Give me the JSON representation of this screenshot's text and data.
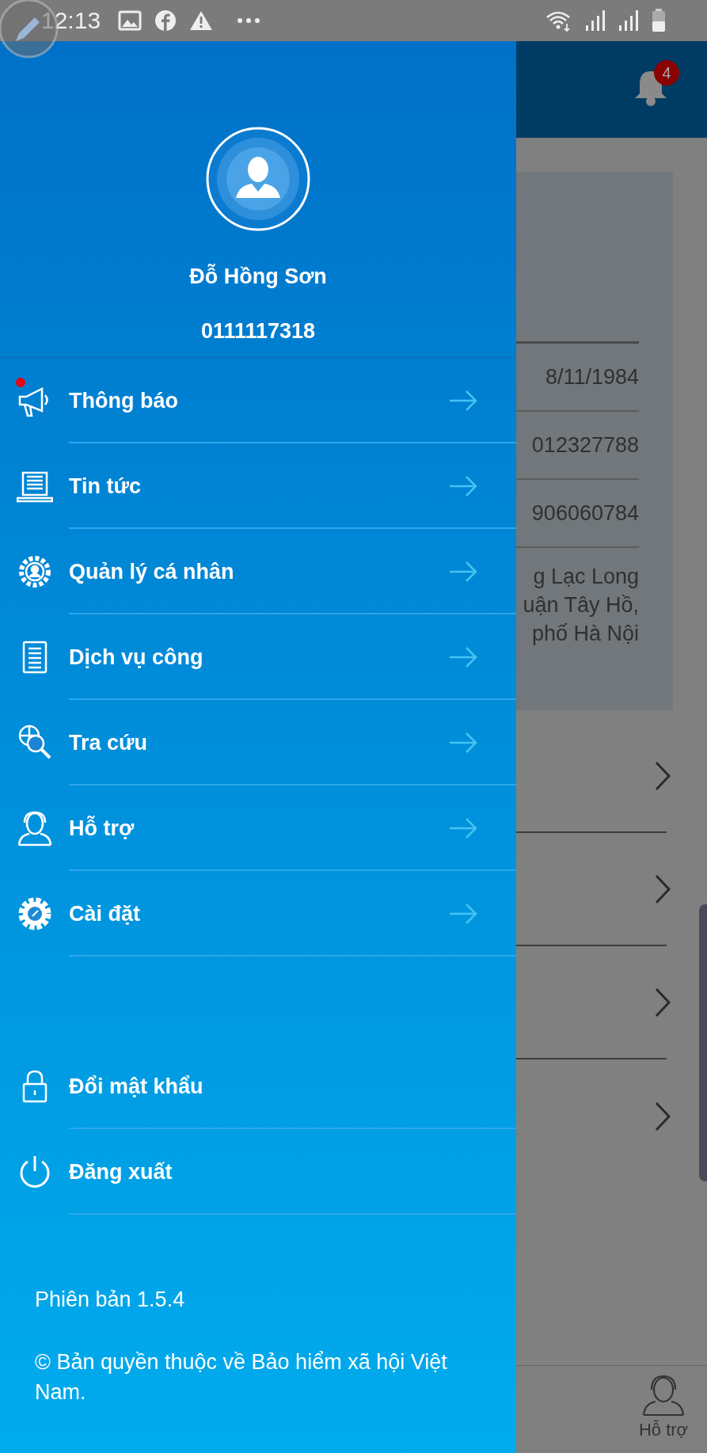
{
  "status_bar": {
    "time": "12:13"
  },
  "background": {
    "notification_badge": "4",
    "info_rows": [
      "8/11/1984",
      "012327788",
      "906060784"
    ],
    "address_lines": [
      "g Lạc Long",
      "uận Tây Hồ,",
      "phố Hà Nội"
    ],
    "bottom_nav": {
      "label": "Hỗ trợ"
    }
  },
  "drawer": {
    "user": {
      "name": "Đỗ Hồng Sơn",
      "id": "0111117318"
    },
    "menu": [
      {
        "label": "Thông báo",
        "has_dot": true
      },
      {
        "label": "Tin tức",
        "has_dot": false
      },
      {
        "label": "Quản lý cá nhân",
        "has_dot": false
      },
      {
        "label": "Dịch vụ công",
        "has_dot": false
      },
      {
        "label": "Tra cứu",
        "has_dot": false
      },
      {
        "label": "Hỗ trợ",
        "has_dot": false
      },
      {
        "label": "Cài đặt",
        "has_dot": false
      }
    ],
    "account": [
      {
        "label": "Đổi mật khẩu"
      },
      {
        "label": "Đăng xuất"
      }
    ],
    "version": "Phiên bản 1.5.4",
    "copyright": "© Bản quyền thuộc về  Bảo hiểm xã hội Việt Nam."
  }
}
